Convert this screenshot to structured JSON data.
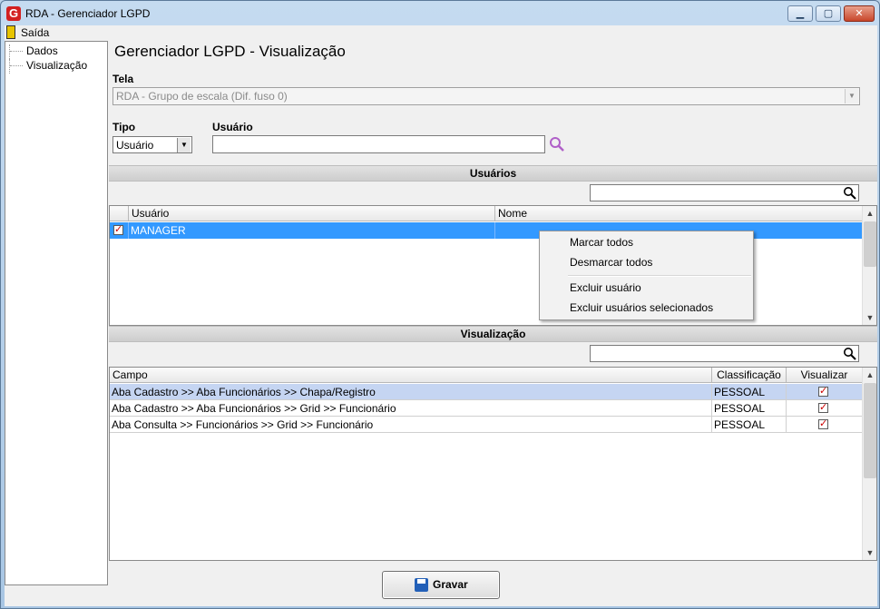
{
  "window": {
    "title": "RDA - Gerenciador LGPD",
    "logo_letter": "G",
    "minimize_glyph": "▁",
    "maximize_glyph": "▢",
    "close_glyph": "✕"
  },
  "menu": {
    "exit_label": "Saída"
  },
  "tree": {
    "items": [
      {
        "label": "Dados"
      },
      {
        "label": "Visualização"
      }
    ]
  },
  "main": {
    "title": "Gerenciador LGPD - Visualização",
    "tela": {
      "label": "Tela",
      "value": "RDA - Grupo de escala (Dif. fuso 0)"
    },
    "tipo": {
      "label": "Tipo",
      "value": "Usuário"
    },
    "usuario": {
      "label": "Usuário",
      "value": ""
    }
  },
  "usuarios_section": {
    "title": "Usuários",
    "filter_value": "",
    "columns": [
      "Usuário",
      "Nome"
    ],
    "rows": [
      {
        "checked": true,
        "usuario": "MANAGER",
        "nome": ""
      }
    ]
  },
  "context_menu": {
    "items": [
      "Marcar todos",
      "Desmarcar todos",
      "Excluir usuário",
      "Excluir usuários selecionados"
    ]
  },
  "visualizacao_section": {
    "title": "Visualização",
    "filter_value": "",
    "columns": [
      "Campo",
      "Classificação",
      "Visualizar"
    ],
    "rows": [
      {
        "campo": "Aba Cadastro >> Aba Funcionários >> Chapa/Registro",
        "classificacao": "PESSOAL",
        "visualizar": true
      },
      {
        "campo": "Aba Cadastro >> Aba Funcionários >> Grid >> Funcionário",
        "classificacao": "PESSOAL",
        "visualizar": true
      },
      {
        "campo": "Aba Consulta >> Funcionários >> Grid >> Funcionário",
        "classificacao": "PESSOAL",
        "visualizar": true
      }
    ]
  },
  "actions": {
    "save_label": "Gravar"
  },
  "icons": {
    "search": "search-icon",
    "dropdown": "chevron-down-icon",
    "scroll_up": "arrow-up-icon",
    "scroll_down": "arrow-down-icon",
    "check": "✓"
  },
  "colors": {
    "selection": "#3399ff",
    "row_highlight": "#c5d5f2",
    "check": "#cc0000",
    "search_icon_accent": "#b060c8"
  }
}
